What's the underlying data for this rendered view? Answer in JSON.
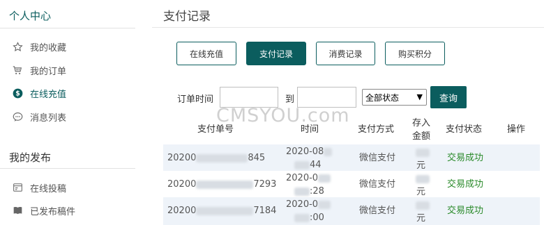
{
  "sidebar": {
    "personal_title": "个人中心",
    "personal_items": [
      {
        "label": "我的收藏",
        "icon": "star-icon"
      },
      {
        "label": "我的订单",
        "icon": "cart-icon"
      },
      {
        "label": "在线充值",
        "icon": "dollar-icon",
        "active": true
      },
      {
        "label": "消息列表",
        "icon": "chat-icon"
      }
    ],
    "publish_title": "我的发布",
    "publish_items": [
      {
        "label": "在线投稿",
        "icon": "form-icon"
      },
      {
        "label": "已发布稿件",
        "icon": "book-icon"
      }
    ]
  },
  "main": {
    "title": "支付记录",
    "tabs": [
      {
        "label": "在线充值"
      },
      {
        "label": "支付记录",
        "active": true
      },
      {
        "label": "消费记录"
      },
      {
        "label": "购买积分"
      }
    ],
    "filter": {
      "time_label": "订单时间",
      "to_label": "到",
      "status_selected": "全部状态",
      "query_label": "查询"
    },
    "watermark": "CMSYOU.com",
    "table": {
      "headers": [
        "支付单号",
        "时间",
        "支付方式",
        "存入",
        "金额",
        "支付状态",
        "操作"
      ],
      "rows": [
        {
          "id_prefix": "20200",
          "id_suffix": "845",
          "time_top": "2020-08",
          "time_bottom": "44",
          "method": "微信支付",
          "amount_unit": "元",
          "status": "交易成功"
        },
        {
          "id_prefix": "20200",
          "id_suffix": "7293",
          "time_top": "2020-0",
          "time_bottom": ":28",
          "method": "微信支付",
          "amount_unit": "元",
          "status": "交易成功"
        },
        {
          "id_prefix": "20200",
          "id_suffix": "7184",
          "time_top": "2020-0",
          "time_bottom": ":00",
          "method": "微信支付",
          "amount_unit": "元",
          "status": "交易成功"
        }
      ]
    }
  },
  "colors": {
    "accent": "#0b5d5e",
    "success": "#2a8a2a",
    "stripe": "#eef3f9"
  }
}
